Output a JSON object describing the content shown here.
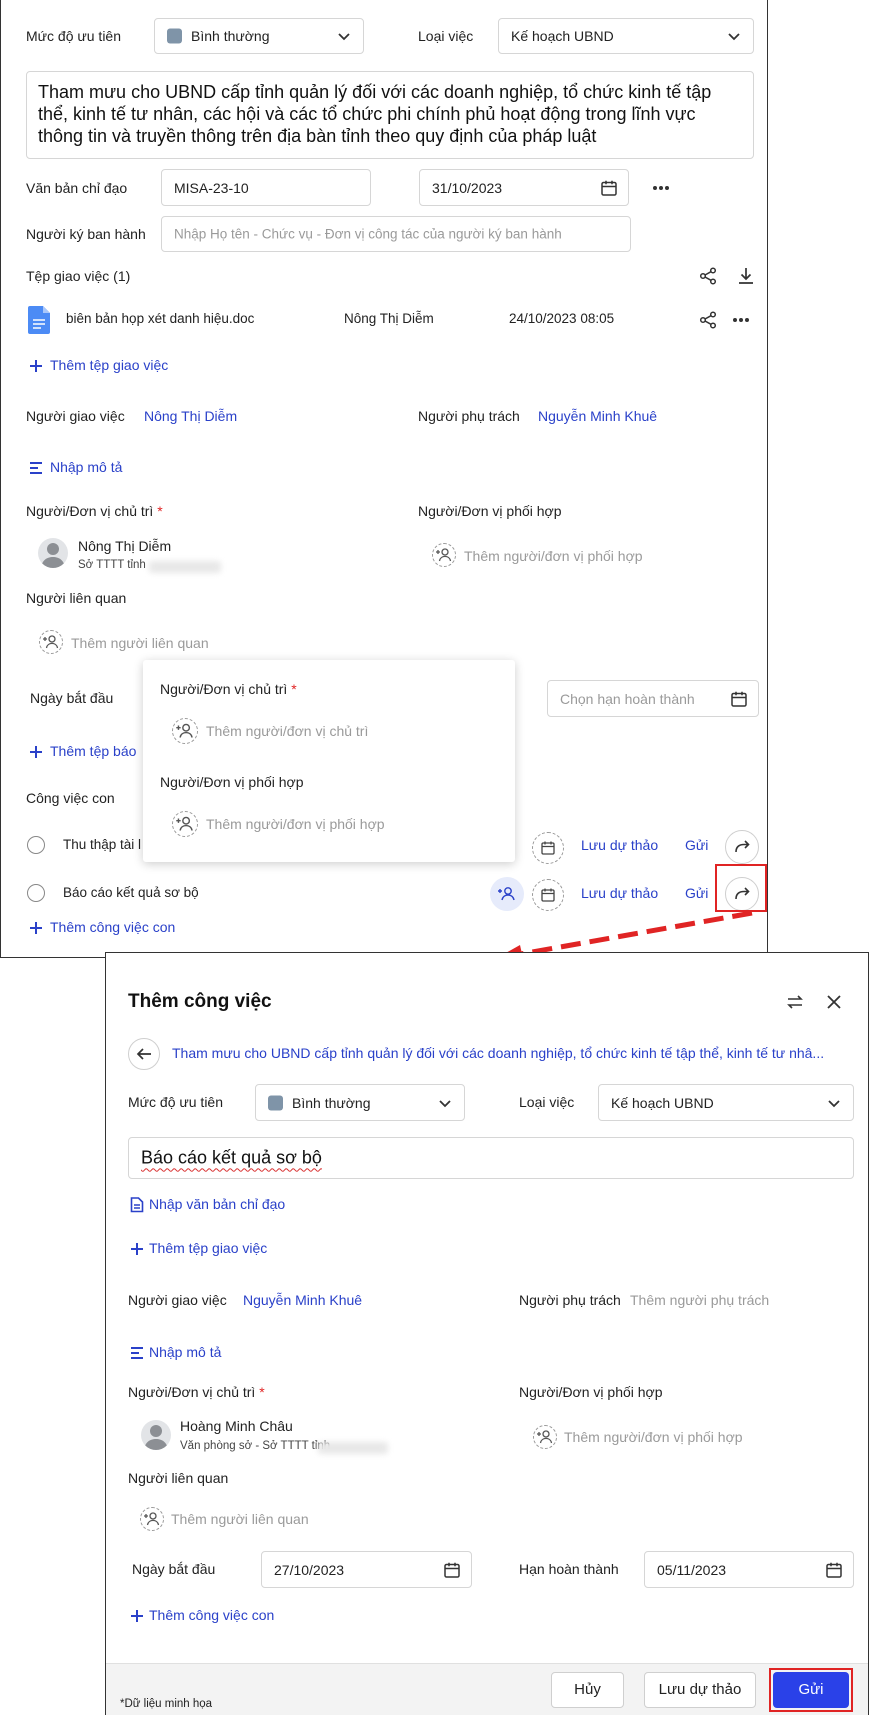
{
  "parent_task": {
    "priority_label": "Mức độ ưu tiên",
    "priority_value": "Bình thường",
    "type_label": "Loại việc",
    "type_value": "Kế hoạch UBND",
    "description": "Tham mưu cho UBND cấp tỉnh quản lý đối với các doanh nghiệp, tổ chức kinh tế tập thể, kinh tế tư nhân, các hội và các tổ chức phi chính phủ hoạt động trong lĩnh vực thông tin và truyền thông trên địa bàn tỉnh theo quy định của pháp luật",
    "directive_label": "Văn bản chỉ đạo",
    "directive_value": "MISA-23-10",
    "directive_date": "31/10/2023",
    "signer_label": "Người ký ban hành",
    "signer_placeholder": "Nhập Họ tên - Chức vụ - Đơn vị công tác của người ký ban hành",
    "files_label": "Tệp giao việc (1)",
    "file": {
      "name": "biên bản họp xét danh hiệu.doc",
      "uploader": "Nông Thị Diễm",
      "time": "24/10/2023 08:05"
    },
    "add_file": "Thêm tệp giao việc",
    "assigner_label": "Người giao việc",
    "assigner_value": "Nông Thị Diễm",
    "owner_label": "Người phụ trách",
    "owner_value": "Nguyễn Minh Khuê",
    "desc_link": "Nhập mô tả",
    "host_label": "Người/Đơn vị chủ trì",
    "host_name": "Nông Thị Diễm",
    "host_org": "Sở TTTT tỉnh",
    "coop_label": "Người/Đơn vị phối hợp",
    "coop_placeholder": "Thêm người/đơn vị phối hợp",
    "related_label": "Người liên quan",
    "related_placeholder": "Thêm người liên quan",
    "start_label": "Ngày bắt đầu",
    "due_placeholder": "Chọn hạn hoàn thành",
    "add_report": "Thêm tệp báo",
    "subtasks_label": "Công việc con",
    "subtasks": [
      {
        "name": "Thu thập tài l"
      },
      {
        "name": "Báo cáo kết quả sơ bộ"
      }
    ],
    "save_draft": "Lưu dự thảo",
    "send": "Gửi",
    "add_subtask": "Thêm công việc con"
  },
  "popup": {
    "host_label": "Người/Đơn vị chủ trì",
    "host_placeholder": "Thêm người/đơn vị chủ trì",
    "coop_label": "Người/Đơn vị phối hợp",
    "coop_placeholder": "Thêm người/đơn vị phối hợp"
  },
  "dialog": {
    "title": "Thêm công việc",
    "parent_ref": "Tham mưu cho UBND cấp tỉnh quản lý đối với các doanh nghiệp, tổ chức kinh tế tập thể, kinh tế tư nhâ...",
    "priority_label": "Mức độ ưu tiên",
    "priority_value": "Bình thường",
    "type_label": "Loại việc",
    "type_value": "Kế hoạch UBND",
    "task_name": "Báo cáo kết quả sơ bộ",
    "directive_link": "Nhập văn bản chỉ đạo",
    "add_file": "Thêm tệp giao việc",
    "assigner_label": "Người giao việc",
    "assigner_value": "Nguyễn Minh Khuê",
    "owner_label": "Người phụ trách",
    "owner_placeholder": "Thêm người phụ trách",
    "desc_link": "Nhập mô tả",
    "host_label": "Người/Đơn vị chủ trì",
    "host_name": "Hoàng Minh Châu",
    "host_org": "Văn phòng sở - Sở TTTT tỉnh",
    "coop_label": "Người/Đơn vị phối hợp",
    "coop_placeholder": "Thêm người/đơn vị phối hợp",
    "related_label": "Người liên quan",
    "related_placeholder": "Thêm người liên quan",
    "start_label": "Ngày bắt đầu",
    "start_value": "27/10/2023",
    "due_label": "Hạn hoàn thành",
    "due_value": "05/11/2023",
    "add_subtask": "Thêm công việc con",
    "cancel": "Hủy",
    "save_draft": "Lưu dự thảo",
    "send": "Gửi",
    "footnote": "*Dữ liệu minh họa"
  },
  "colors": {
    "accent": "#2a41c9",
    "primary_button": "#2a41e8",
    "highlight": "#e02424"
  }
}
